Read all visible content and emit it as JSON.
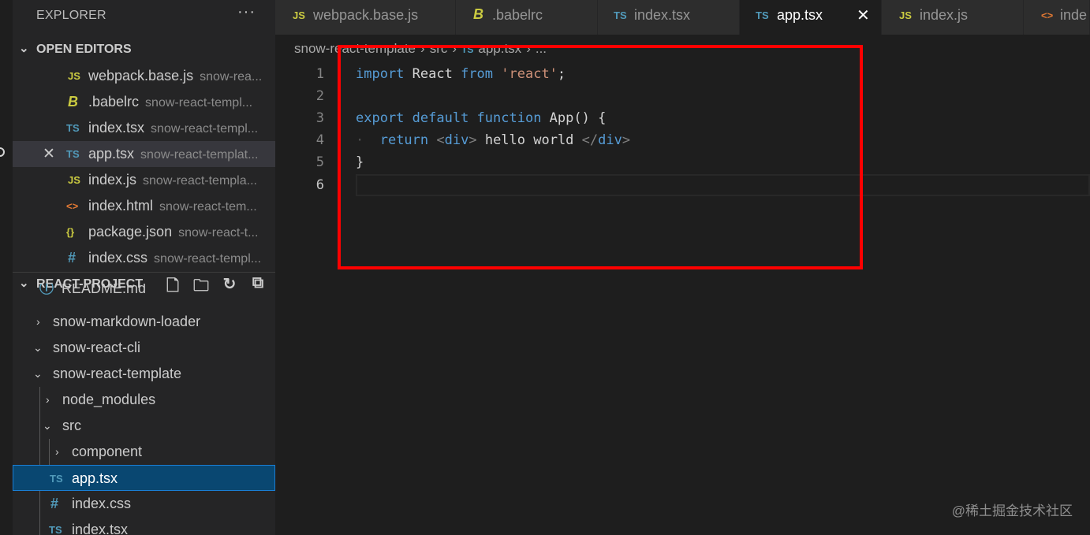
{
  "explorer": {
    "title": "EXPLORER",
    "more_label": "···"
  },
  "open_editors": {
    "title": "OPEN EDITORS",
    "items": [
      {
        "icon": "JS",
        "name": "webpack.base.js",
        "desc": "snow-rea..."
      },
      {
        "icon": "B",
        "name": ".babelrc",
        "desc": "snow-react-templ..."
      },
      {
        "icon": "TS",
        "name": "index.tsx",
        "desc": "snow-react-templ..."
      },
      {
        "icon": "TS",
        "name": "app.tsx",
        "desc": "snow-react-templat...",
        "close": "✕"
      },
      {
        "icon": "JS",
        "name": "index.js",
        "desc": "snow-react-templa..."
      },
      {
        "icon": "<>",
        "name": "index.html",
        "desc": "snow-react-tem..."
      },
      {
        "icon": "{}",
        "name": "package.json",
        "desc": "snow-react-t..."
      },
      {
        "icon": "#",
        "name": "index.css",
        "desc": "snow-react-templ..."
      }
    ]
  },
  "project": {
    "title": "REACT-PROJECT",
    "tree": [
      {
        "icon": "ⓘ",
        "name": "README.md"
      },
      {
        "chevron": "›",
        "name": "snow-markdown-loader"
      },
      {
        "chevron": "⌄",
        "name": "snow-react-cli"
      },
      {
        "chevron": "⌄",
        "name": "snow-react-template"
      },
      {
        "chevron": "›",
        "name": "node_modules"
      },
      {
        "chevron": "⌄",
        "name": "src"
      },
      {
        "chevron": "›",
        "name": "component"
      },
      {
        "icon": "TS",
        "name": "app.tsx"
      },
      {
        "icon": "#",
        "name": "index.css"
      },
      {
        "icon": "TS",
        "name": "index.tsx"
      }
    ]
  },
  "tabs": [
    {
      "icon": "JS",
      "label": "webpack.base.js"
    },
    {
      "icon": "B",
      "label": ".babelrc"
    },
    {
      "icon": "TS",
      "label": "index.tsx"
    },
    {
      "icon": "TS",
      "label": "app.tsx",
      "close": "✕"
    },
    {
      "icon": "JS",
      "label": "index.js"
    },
    {
      "icon": "<>",
      "label": "inde"
    }
  ],
  "breadcrumb": {
    "parts": [
      "snow-react-template",
      "src",
      "app.tsx",
      "..."
    ],
    "sep": "›",
    "file_icon": "TS"
  },
  "code": {
    "line_numbers": [
      "1",
      "2",
      "3",
      "4",
      "5",
      "6"
    ],
    "line1": {
      "kw1": "import",
      "ident": " React ",
      "kw2": "from",
      "str": " 'react'",
      "punc": ";"
    },
    "line3": {
      "kw1": "export",
      "kw2": " default",
      "kw3": " function",
      "rest": " App() {"
    },
    "line4": {
      "indent_dots": "· ",
      "kw": " return",
      "open_lt": " <",
      "tag1": "div",
      "open_gt": ">",
      "text": " hello world ",
      "close_lt": "</",
      "tag2": "div",
      "close_gt": ">"
    },
    "line5": {
      "text": "}"
    }
  },
  "watermark": "@稀土掘金技术社区",
  "colors": {
    "keyword": "#569cd6",
    "string": "#ce9178",
    "highlight_box": "#ff0000",
    "selection": "#094771"
  }
}
